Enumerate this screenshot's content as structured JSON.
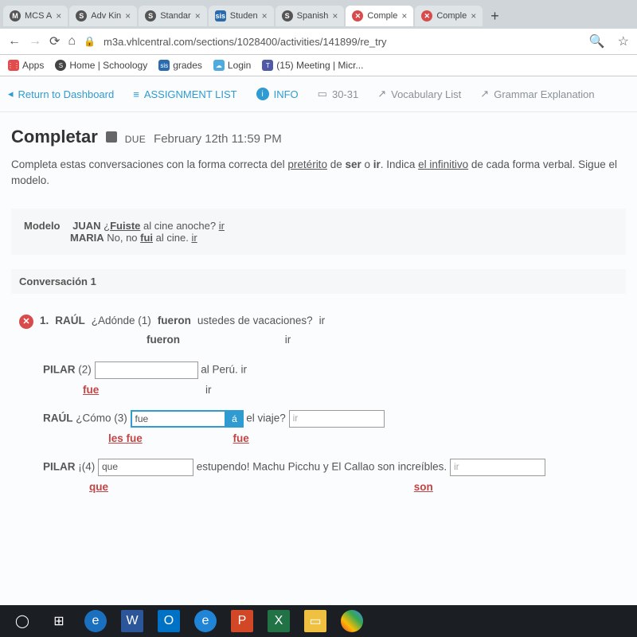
{
  "tabs": [
    {
      "label": "MCS A",
      "favicon": "M"
    },
    {
      "label": "Adv Kin",
      "favicon": "S"
    },
    {
      "label": "Standar",
      "favicon": "S"
    },
    {
      "label": "Studen",
      "favicon": "sis"
    },
    {
      "label": "Spanish",
      "favicon": "S"
    },
    {
      "label": "Comple",
      "favicon": "✕",
      "active": true
    },
    {
      "label": "Comple",
      "favicon": "✕"
    }
  ],
  "url": "m3a.vhlcentral.com/sections/1028400/activities/141899/re_try",
  "bookmarks": [
    {
      "label": "Apps",
      "ico": "⋮⋮"
    },
    {
      "label": "Home | Schoology",
      "ico": "S"
    },
    {
      "label": "grades",
      "ico": "sis"
    },
    {
      "label": "Login",
      "ico": "☁"
    },
    {
      "label": "(15) Meeting | Micr...",
      "ico": "T"
    }
  ],
  "topnav": {
    "return": "Return to Dashboard",
    "assignment": "ASSIGNMENT LIST",
    "info": "INFO",
    "pages": "30-31",
    "vocab": "Vocabulary List",
    "grammar": "Grammar Explanation"
  },
  "title": "Completar",
  "due_label": "DUE",
  "due_date": "February 12th 11:59 PM",
  "instructions": {
    "pre": "Completa estas conversaciones con la forma correcta del ",
    "u1": "pretérito",
    "mid1": " de ",
    "b1": "ser",
    "mid2": " o ",
    "b2": "ir",
    "mid3": ". Indica ",
    "u2": "el infinitivo",
    "post": " de cada forma verbal. Sigue el modelo."
  },
  "modelo": {
    "label": "Modelo",
    "line1_speaker": "JUAN",
    "line1_pre": " ¿",
    "line1_u": "Fuiste",
    "line1_post": " al cine anoche? ",
    "line1_inf": "ir",
    "line2_speaker": "MARIA",
    "line2_pre": " No, no ",
    "line2_u": "fui",
    "line2_post": " al cine. ",
    "line2_inf": "ir"
  },
  "conv_label": "Conversación 1",
  "q1": {
    "num": "1.",
    "speaker": "RAÚL",
    "pre": " ¿Adónde (1) ",
    "given": "fueron",
    "post": " ustedes de vacaciones? ",
    "inf": "ir",
    "ans_word": "fueron",
    "ans_inf": "ir"
  },
  "q2": {
    "speaker": "PILAR",
    "pre": " (2) ",
    "post": " al Perú. ",
    "inf": "ir",
    "corr": "fue",
    "corr_inf": "ir"
  },
  "q3": {
    "speaker": "RAÚL",
    "pre": " ¿Cómo (3) ",
    "input_val": "fue",
    "accent": "á",
    "mid": " el viaje? ",
    "input2_ph": "ir",
    "corr1": "les fue",
    "corr2": "fue"
  },
  "q4": {
    "speaker": "PILAR",
    "pre": " ¡(4) ",
    "input_val": "que",
    "mid": " estupendo! Machu Picchu y El Callao son increíbles. ",
    "input2_ph": "ir",
    "corr1": "que",
    "corr2": "son"
  }
}
